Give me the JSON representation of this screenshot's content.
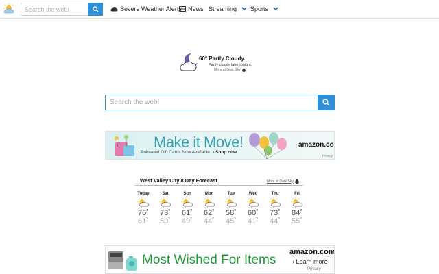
{
  "header": {
    "search_placeholder": "Search the web!",
    "nav": {
      "weather": "Severe Weather Alerts",
      "news": "News",
      "streaming": "Streaming",
      "sports": "Sports"
    }
  },
  "current_weather": {
    "line1": "60° Partly Cloudy.",
    "line2": "Partly cloudy later tonight.",
    "line3": "More at Dark Sky"
  },
  "main_search": {
    "placeholder": "Search the web!"
  },
  "ad1": {
    "title": "Make it Move!",
    "subtitle": "Animated Gift Cards Now Available",
    "cta": "› Shop now",
    "brand": "amazon.com",
    "privacy": "Privacy"
  },
  "forecast": {
    "title": "West Valley City 8 Day Forecast",
    "more": "More at Dark Sky",
    "days": [
      {
        "name": "Today",
        "hi": "76˚",
        "lo": "61˚"
      },
      {
        "name": "Sat",
        "hi": "73˚",
        "lo": "50˚"
      },
      {
        "name": "Sun",
        "hi": "61˚",
        "lo": "49˚"
      },
      {
        "name": "Mon",
        "hi": "62˚",
        "lo": "44˚"
      },
      {
        "name": "Tue",
        "hi": "58˚",
        "lo": "45˚"
      },
      {
        "name": "Wed",
        "hi": "60˚",
        "lo": "41˚"
      },
      {
        "name": "Thu",
        "hi": "73˚",
        "lo": "44˚"
      },
      {
        "name": "Fri",
        "hi": "84˚",
        "lo": "55˚"
      }
    ]
  },
  "ad2": {
    "title": "Most Wished For Items",
    "brand": "amazon.com",
    "cta": "› Learn more",
    "privacy": "Privacy"
  },
  "colors": {
    "accent": "#2f8fd8",
    "ad1_title": "#3a9fb0",
    "ad2_title": "#1f9a3a"
  }
}
